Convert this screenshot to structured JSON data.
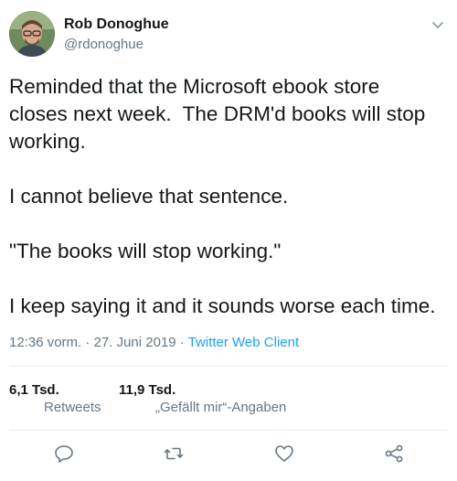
{
  "author": {
    "display_name": "Rob Donoghue",
    "handle": "@rdonoghue"
  },
  "tweet": {
    "text": "Reminded that the Microsoft ebook store\ncloses next week.  The DRM'd books will stop\nworking.\n\nI cannot believe that sentence.\n\n\"The books will stop working.\"\n\nI keep saying it and it sounds worse each time."
  },
  "meta": {
    "time": "12:36 vorm.",
    "separator1": " · ",
    "date": "27. Juni 2019",
    "separator2": " · ",
    "client": "Twitter Web Client"
  },
  "stats": {
    "retweets_count": "6,1 Tsd.",
    "retweets_label": "Retweets",
    "likes_count": "11,9 Tsd.",
    "likes_label": "„Gefällt mir“-Angaben"
  },
  "icons": {
    "menu": "chevron-down-icon",
    "reply": "reply-icon",
    "retweet": "retweet-icon",
    "like": "heart-icon",
    "share": "share-icon"
  },
  "colors": {
    "text": "#14171a",
    "muted": "#657786",
    "link": "#1da1f2",
    "divider": "#e6ecf0"
  }
}
